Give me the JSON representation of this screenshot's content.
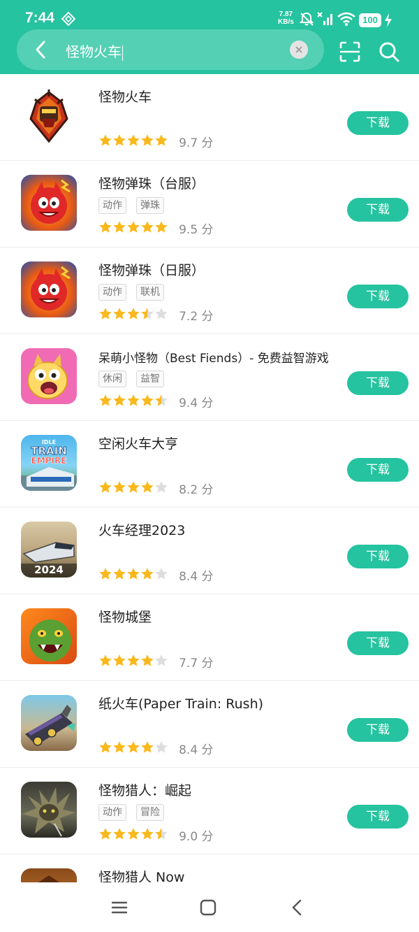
{
  "status_bar": {
    "time": "7:44",
    "net_speed_value": "7.87",
    "net_speed_unit": "KB/s",
    "battery": "100"
  },
  "search": {
    "query": "怪物火车"
  },
  "colors": {
    "accent": "#25c39f",
    "star": "#f9b81c",
    "star_empty": "#dddddd"
  },
  "apps": [
    {
      "name": "怪物火车",
      "tags": [],
      "rating": 5,
      "score": "9.7 分",
      "button": "下载"
    },
    {
      "name": "怪物弹珠（台服）",
      "tags": [
        "动作",
        "弹珠"
      ],
      "rating": 5,
      "score": "9.5 分",
      "button": "下载"
    },
    {
      "name": "怪物弹珠（日服）",
      "tags": [
        "动作",
        "联机"
      ],
      "rating": 3.5,
      "score": "7.2 分",
      "button": "下载"
    },
    {
      "name": "呆萌小怪物（Best Fiends）- 免费益智游戏",
      "tags": [
        "休闲",
        "益智"
      ],
      "rating": 4.5,
      "score": "9.4 分",
      "button": "下载"
    },
    {
      "name": "空闲火车大亨",
      "tags": [],
      "rating": 4,
      "score": "8.2 分",
      "button": "下载",
      "icon_text": [
        "IDLE",
        "TRAIN",
        "EMPIRE"
      ]
    },
    {
      "name": "火车经理2023",
      "tags": [],
      "rating": 4,
      "score": "8.4 分",
      "button": "下载",
      "icon_text": [
        "2024"
      ]
    },
    {
      "name": "怪物城堡",
      "tags": [],
      "rating": 4,
      "score": "7.7 分",
      "button": "下载"
    },
    {
      "name": "纸火车(Paper Train: Rush)",
      "tags": [],
      "rating": 4,
      "score": "8.4 分",
      "button": "下载"
    },
    {
      "name": "怪物猎人：崛起",
      "tags": [
        "动作",
        "冒险"
      ],
      "rating": 4.5,
      "score": "9.0 分",
      "button": "下载"
    },
    {
      "name": "怪物猎人 Now",
      "tags": [],
      "rating": 0,
      "score": "",
      "button": ""
    }
  ],
  "nav_bar": {
    "icons": [
      "menu-icon",
      "home-icon",
      "back-icon"
    ]
  }
}
